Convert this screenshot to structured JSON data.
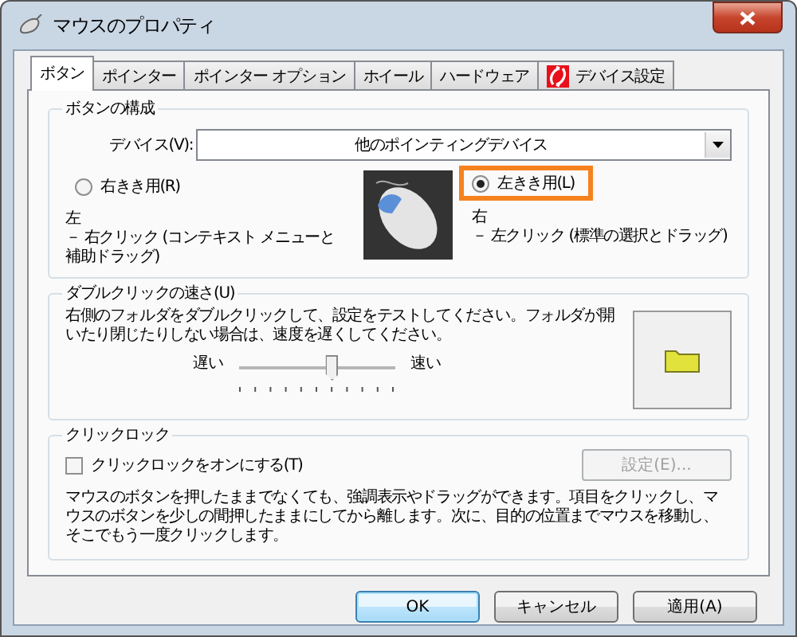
{
  "window": {
    "title": "マウスのプロパティ"
  },
  "tabs": [
    {
      "label": "ボタン",
      "selected": true,
      "kind": "text"
    },
    {
      "label": "ポインター",
      "selected": false,
      "kind": "text"
    },
    {
      "label": "ポインター オプション",
      "selected": false,
      "kind": "text"
    },
    {
      "label": "ホイール",
      "selected": false,
      "kind": "text"
    },
    {
      "label": "ハードウェア",
      "selected": false,
      "kind": "text"
    },
    {
      "label": "デバイス設定",
      "selected": false,
      "kind": "icon"
    }
  ],
  "button_config": {
    "title": "ボタンの構成",
    "device_label": "デバイス(V):",
    "device_value": "他のポインティングデバイス",
    "radios": [
      {
        "label": "右きき用(R)",
        "selected": false,
        "highlight": false
      },
      {
        "label": "左きき用(L)",
        "selected": true,
        "highlight": true
      }
    ],
    "descriptions": [
      {
        "heading": "左",
        "text": "－ 右クリック (コンテキスト メニューと補助ドラッグ)"
      },
      {
        "heading": "右",
        "text": "－ 左クリック (標準の選択とドラッグ)"
      }
    ]
  },
  "double_click": {
    "title": "ダブルクリックの速さ(U)",
    "text": "右側のフォルダをダブルクリックして、設定をテストしてください。フォルダが開いたり閉じたりしない場合は、速度を遅くしてください。",
    "slow": "遅い",
    "fast": "速い",
    "level": 0.6
  },
  "click_lock": {
    "title": "クリックロック",
    "checkbox": {
      "label": "クリックロックをオンにする(T)",
      "checked": false
    },
    "settings_button": {
      "label": "設定(E)...",
      "disabled": true
    },
    "text": "マウスのボタンを押したままでなくても、強調表示やドラッグができます。項目をクリックし、マウスのボタンを少しの間押したままにしてから離します。次に、目的の位置までマウスを移動し、そこでもう一度クリックします。"
  },
  "buttons": [
    {
      "label": "OK",
      "default": true
    },
    {
      "label": "キャンセル",
      "default": false
    },
    {
      "label": "適用(A)",
      "default": false
    }
  ]
}
